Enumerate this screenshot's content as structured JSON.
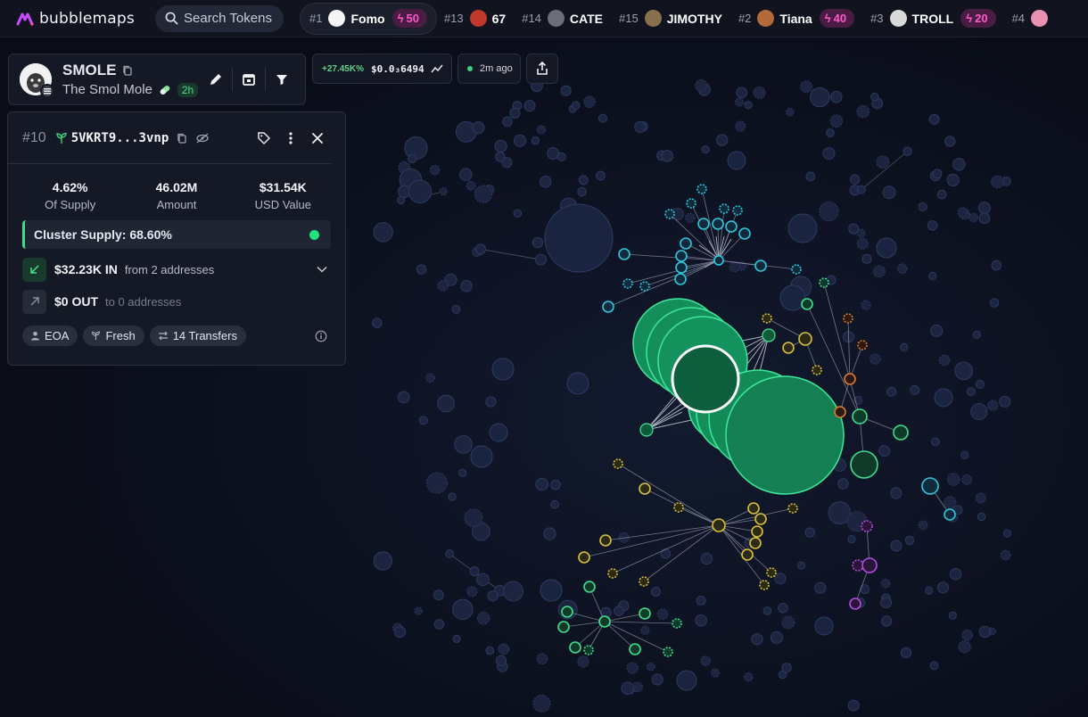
{
  "app": {
    "name": "bubblemaps"
  },
  "search": {
    "label": "Search Tokens"
  },
  "ticker": [
    {
      "rank": "#1",
      "name": "Fomo",
      "boost": "50",
      "avatar_color": "#f5f5f5",
      "selected": true
    },
    {
      "rank": "#13",
      "name": "67",
      "boost": "",
      "avatar_color": "#c0392b",
      "selected": false
    },
    {
      "rank": "#14",
      "name": "CATE",
      "boost": "",
      "avatar_color": "#6b6f7b",
      "selected": false
    },
    {
      "rank": "#15",
      "name": "JIMOTHY",
      "boost": "",
      "avatar_color": "#8a6f4e",
      "selected": false
    },
    {
      "rank": "#2",
      "name": "Tiana",
      "boost": "40",
      "avatar_color": "#b56a3a",
      "selected": false
    },
    {
      "rank": "#3",
      "name": "TROLL",
      "boost": "20",
      "avatar_color": "#d9d9d9",
      "selected": false
    },
    {
      "rank": "#4",
      "name": "",
      "boost": "",
      "avatar_color": "#e891b0",
      "selected": false
    }
  ],
  "token": {
    "symbol": "SMOLE",
    "name": "The Smol Mole",
    "age": "2h",
    "price_change": "+27.45K%",
    "price": "$0.0₃6494",
    "updated": "2m ago"
  },
  "wallet": {
    "rank": "#10",
    "address": "5VKRT9...3vnp",
    "stats": [
      {
        "value": "4.62%",
        "label": "Of Supply"
      },
      {
        "value": "46.02M",
        "label": "Amount"
      },
      {
        "value": "$31.54K",
        "label": "USD Value"
      }
    ],
    "cluster_supply": "Cluster Supply: 68.60%",
    "inflow": {
      "amount": "$32.23K IN",
      "detail": "from 2 addresses"
    },
    "outflow": {
      "amount": "$0 OUT",
      "detail": "to 0 addresses"
    },
    "tags": [
      "EOA",
      "Fresh",
      "14 Transfers"
    ]
  },
  "colors": {
    "accent_green": "#3edf8c",
    "cluster_teal": "#2fc7e0",
    "cluster_yellow": "#d9c13a",
    "cluster_purple": "#b24de0",
    "cluster_orange": "#e07a2a",
    "bubble_default": "#1c2440",
    "boost_pink": "#ff58c8"
  }
}
